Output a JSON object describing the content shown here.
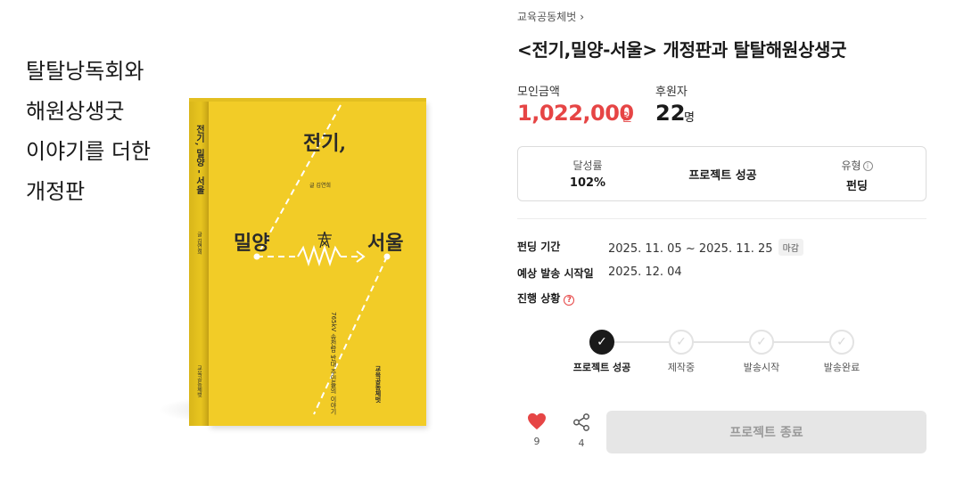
{
  "cover": {
    "tagline": [
      "탈탈낭독회와",
      "해원상생굿",
      "이야기를 더한",
      "개정판"
    ],
    "book_title_top": "전기,",
    "book_title_left": "밀양",
    "book_title_right": "서울",
    "book_author": "글 김연희",
    "book_spine_title": "전기, 밀양 - 서울",
    "book_publisher": "교육공동체벗",
    "book_subtitle": "765kV 송전탑 반대 주민들의 이야기"
  },
  "project": {
    "maker": "교육공동체벗",
    "title": "<전기,밀양-서울> 개정판과 탈탈해원상생굿",
    "amount_label": "모인금액",
    "amount": "1,022,000",
    "amount_unit": "원",
    "backers_label": "후원자",
    "backers": "22",
    "backers_unit": "명"
  },
  "summary": {
    "rate_label": "달성률",
    "rate": "102%",
    "status": "프로젝트 성공",
    "type_label": "유형",
    "type": "펀딩"
  },
  "details": {
    "period_label": "펀딩 기간",
    "period": "2025. 11. 05 ~ 2025. 11. 25",
    "period_badge": "마감",
    "ship_label": "예상 발송 시작일",
    "ship": "2025. 12. 04",
    "progress_label": "진행 상황"
  },
  "steps": [
    {
      "label": "프로젝트 성공",
      "active": true
    },
    {
      "label": "제작중",
      "active": false
    },
    {
      "label": "발송시작",
      "active": false
    },
    {
      "label": "발송완료",
      "active": false
    }
  ],
  "actions": {
    "like_count": "9",
    "share_count": "4",
    "end_label": "프로젝트 종료"
  },
  "colors": {
    "accent": "#e64545",
    "book_yellow": "#f2cc27"
  }
}
